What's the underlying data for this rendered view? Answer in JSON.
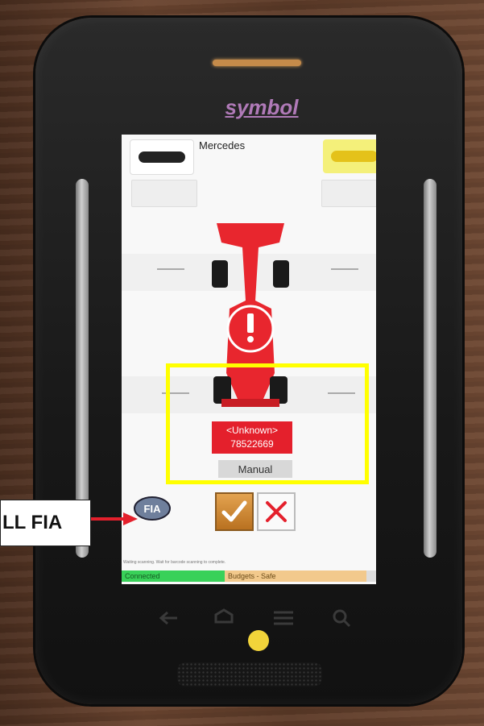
{
  "device": {
    "brand": "symbol"
  },
  "screen": {
    "title": "Mercedes",
    "left_button_label": "",
    "right_button_label": "",
    "badge": {
      "line1": "<Unknown>",
      "line2": "78522669"
    },
    "manual_label": "Manual",
    "fia_label": "FIA",
    "status_message": "Waiting scanning. Wait for barcode scanning to complete.",
    "status": {
      "connected": "Connected",
      "budgets": "Budgets - Safe"
    }
  },
  "callout": {
    "text": "LL FIA"
  },
  "colors": {
    "highlight": "#ffff00",
    "badge": "#e4202c",
    "car": "#e8262e",
    "connected": "#39d159",
    "budgets": "#f2c98c"
  },
  "icons": [
    "warning-icon",
    "fia-icon",
    "check-icon",
    "close-icon",
    "back-icon",
    "home-icon",
    "menu-icon",
    "search-icon"
  ]
}
